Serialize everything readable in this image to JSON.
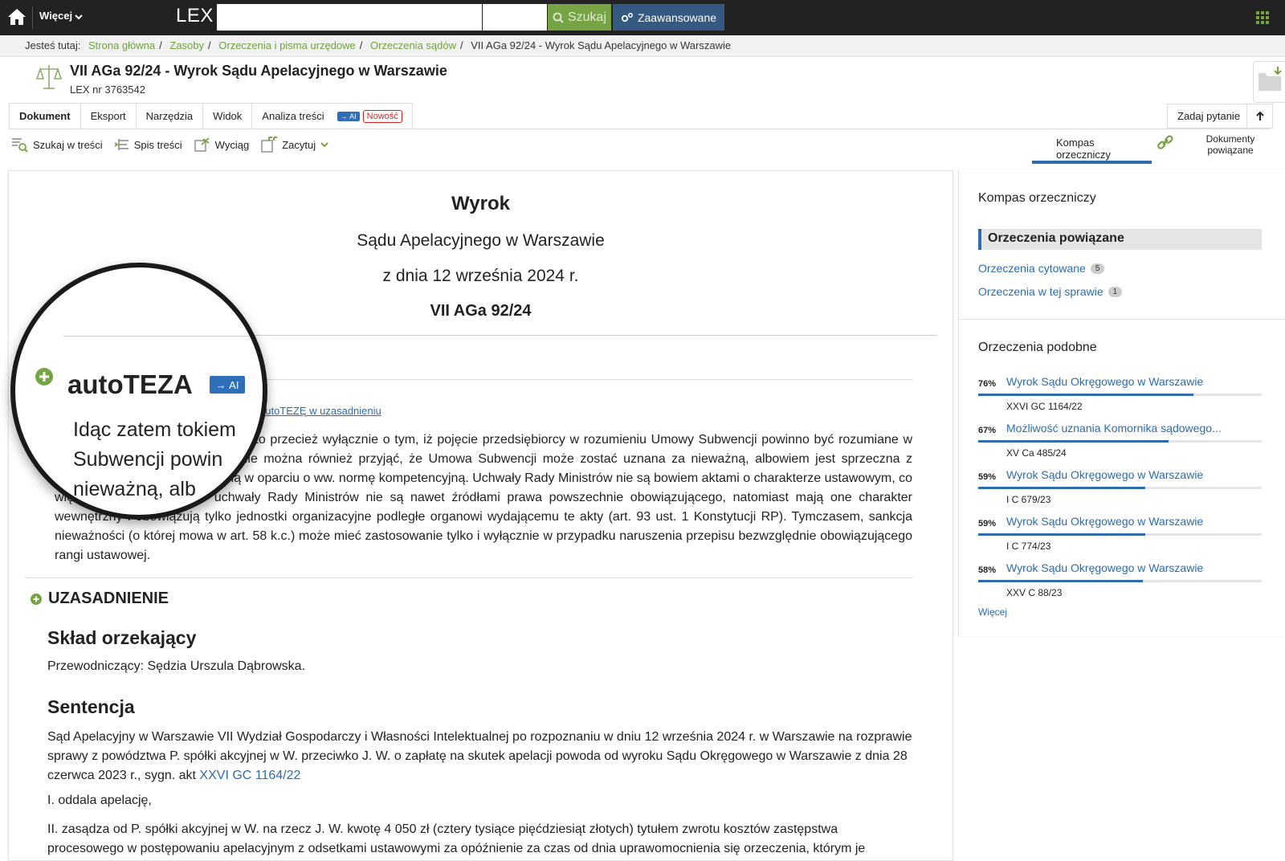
{
  "topbar": {
    "more_label": "Więcej",
    "logo": "LEX",
    "search_value": "",
    "search_button": "Szukaj",
    "advanced_button": "Zaawansowane",
    "home_icon": "home-icon",
    "apps_icon": "apps-grid-icon"
  },
  "breadcrumb": {
    "label": "Jesteś tutaj:",
    "items": [
      "Strona główna",
      "Zasoby",
      "Orzeczenia i pisma urzędowe",
      "Orzeczenia sądów"
    ],
    "current": "VII AGa 92/24 - Wyrok Sądu Apelacyjnego w Warszawie"
  },
  "document": {
    "title": "VII AGa 92/24 - Wyrok Sądu Apelacyjnego w Warszawie",
    "lex_nr": "LEX nr 3763542"
  },
  "tabs": {
    "items": [
      "Dokument",
      "Eksport",
      "Narzędzia",
      "Widok",
      "Analiza treści"
    ],
    "ai_badge": "AI",
    "new_badge": "Nowość",
    "ask_button": "Zadaj pytanie"
  },
  "toolbar": {
    "search_in_content": "Szukaj w treści",
    "toc": "Spis treści",
    "extract": "Wyciąg",
    "cite": "Zacytuj",
    "kompas": "Kompas orzeczniczy",
    "related_docs": "Dokumenty powiązane"
  },
  "judgment": {
    "heading": "Wyrok",
    "court": "Sądu Apelacyjnego w Warszawie",
    "date": "z dnia 12 września 2024 r.",
    "signature": "VII AGa 92/24",
    "teza_link": "autoTEZĘ w uzasadnieniu",
    "teza_text": "a strony powodowej świadczyłoby to przecież wyłącznie o tym, iż pojęcie przedsiębiorcy w rozumieniu Umowy Subwencji powinno być rozumiane w sposób szeroki (funkcjonalny). Nie można również przyjąć, że Umowa Subwencji może zostać uznana za nieważną, albowiem jest sprzeczna z uchwałą Rady Ministrów wydaną w oparciu o ww. normę kompetencyjną. Uchwały Rady Ministrów nie są bowiem aktami o charakterze ustawowym, co więcej wg Konstytucji RP uchwały Rady Ministrów nie są nawet źródłami prawa powszechnie obowiązującego, natomiast mają one charakter wewnętrzny i obowiązują tylko jednostki organizacyjne podległe organowi wydającemu te akty (art. 93 ust. 1 Konstytucji RP). Tymczasem, sankcja nieważności (o której mowa w art. 58 k.c.) może mieć zastosowanie tylko i wyłącznie w przypadku naruszenia przepisu bezwzględnie obowiązującego rangi ustawowej.",
    "uzasadnienie": "UZASADNIENIE",
    "sklad_heading": "Skład orzekający",
    "przewodniczacy": "Przewodniczący: Sędzia Urszula Dąbrowska.",
    "sentencja_heading": "Sentencja",
    "sentencja_text": "Sąd Apelacyjny w Warszawie VII Wydział Gospodarczy i Własności Intelektualnej po rozpoznaniu w dniu 12 września 2024 r. w Warszawie na rozprawie sprawy z powództwa P. spółki akcyjnej w W. przeciwko J. W. o zapłatę na skutek apelacji powoda od wyroku Sądu Okręgowego w Warszawie z dnia 28 czerwca 2023 r., sygn. akt ",
    "sentencja_link": "XXVI GC 1164/22",
    "point1": "I. oddala apelację,",
    "point2": "II. zasądza od P. spółki akcyjnej w W. na rzecz J. W. kwotę 4 050 zł (cztery tysiące pięćdziesiąt złotych) tytułem zwrotu kosztów zastępstwa procesowego w postępowaniu apelacyjnym z odsetkami ustawowymi za opóźnienie za czas od dnia uprawomocnienia się orzeczenia, którym je"
  },
  "magnifier": {
    "title": "autoTEZA",
    "ai_badge": "AI",
    "line1": "Idąc zatem tokiem",
    "line2": "Subwencji powin",
    "line3": "nieważną, alb"
  },
  "right_panel": {
    "title": "Kompas orzeczniczy",
    "section": "Orzeczenia powiązane",
    "links": [
      {
        "label": "Orzeczenia cytowane",
        "count": "5"
      },
      {
        "label": "Orzeczenia w tej sprawie",
        "count": "1"
      }
    ],
    "similar_title": "Orzeczenia podobne",
    "similar": [
      {
        "pct": "76%",
        "value": 76,
        "title": "Wyrok Sądu Okręgowego w Warszawie",
        "sig": "XXVI GC 1164/22"
      },
      {
        "pct": "67%",
        "value": 67,
        "title": "Możliwość uznania Komornika sądowego...",
        "sig": "XV Ca 485/24"
      },
      {
        "pct": "59%",
        "value": 59,
        "title": "Wyrok Sądu Okręgowego w Warszawie",
        "sig": "I C 679/23"
      },
      {
        "pct": "59%",
        "value": 59,
        "title": "Wyrok Sądu Okręgowego w Warszawie",
        "sig": "I C 774/23"
      },
      {
        "pct": "58%",
        "value": 58,
        "title": "Wyrok Sądu Okręgowego w Warszawie",
        "sig": "XXV C 88/23"
      }
    ],
    "more": "Więcej"
  },
  "colors": {
    "accent_green": "#76a444",
    "accent_blue": "#2e6cad",
    "link_blue": "#2b6cb0",
    "topbar": "#222222"
  }
}
